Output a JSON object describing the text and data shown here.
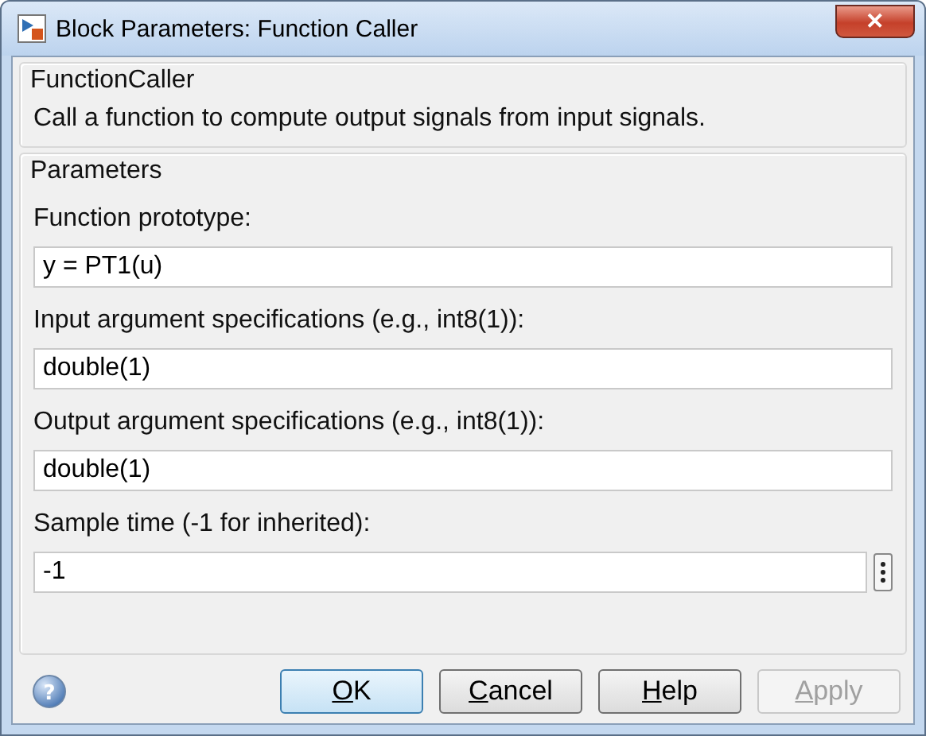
{
  "window": {
    "title": "Block Parameters: Function Caller",
    "close": "✕"
  },
  "description": {
    "title": "FunctionCaller",
    "text": "Call a function to compute output signals from input signals."
  },
  "parameters": {
    "title": "Parameters",
    "fields": [
      {
        "label": "Function prototype:",
        "value": "y = PT1(u)",
        "kind": "plain"
      },
      {
        "label": "Input argument specifications (e.g., int8(1)):",
        "value": "double(1)",
        "kind": "plain"
      },
      {
        "label": "Output argument specifications (e.g., int8(1)):",
        "value": "double(1)",
        "kind": "plain"
      },
      {
        "label": "Sample time (-1 for inherited):",
        "value": "-1",
        "kind": "more"
      }
    ]
  },
  "help_icon": "?",
  "buttons": [
    {
      "key": "O",
      "rest": "K",
      "default": true,
      "disabled": false
    },
    {
      "key": "C",
      "rest": "ancel",
      "default": false,
      "disabled": false
    },
    {
      "key": "H",
      "rest": "elp",
      "default": false,
      "disabled": false
    },
    {
      "key": "A",
      "rest": "pply",
      "default": false,
      "disabled": true
    }
  ]
}
